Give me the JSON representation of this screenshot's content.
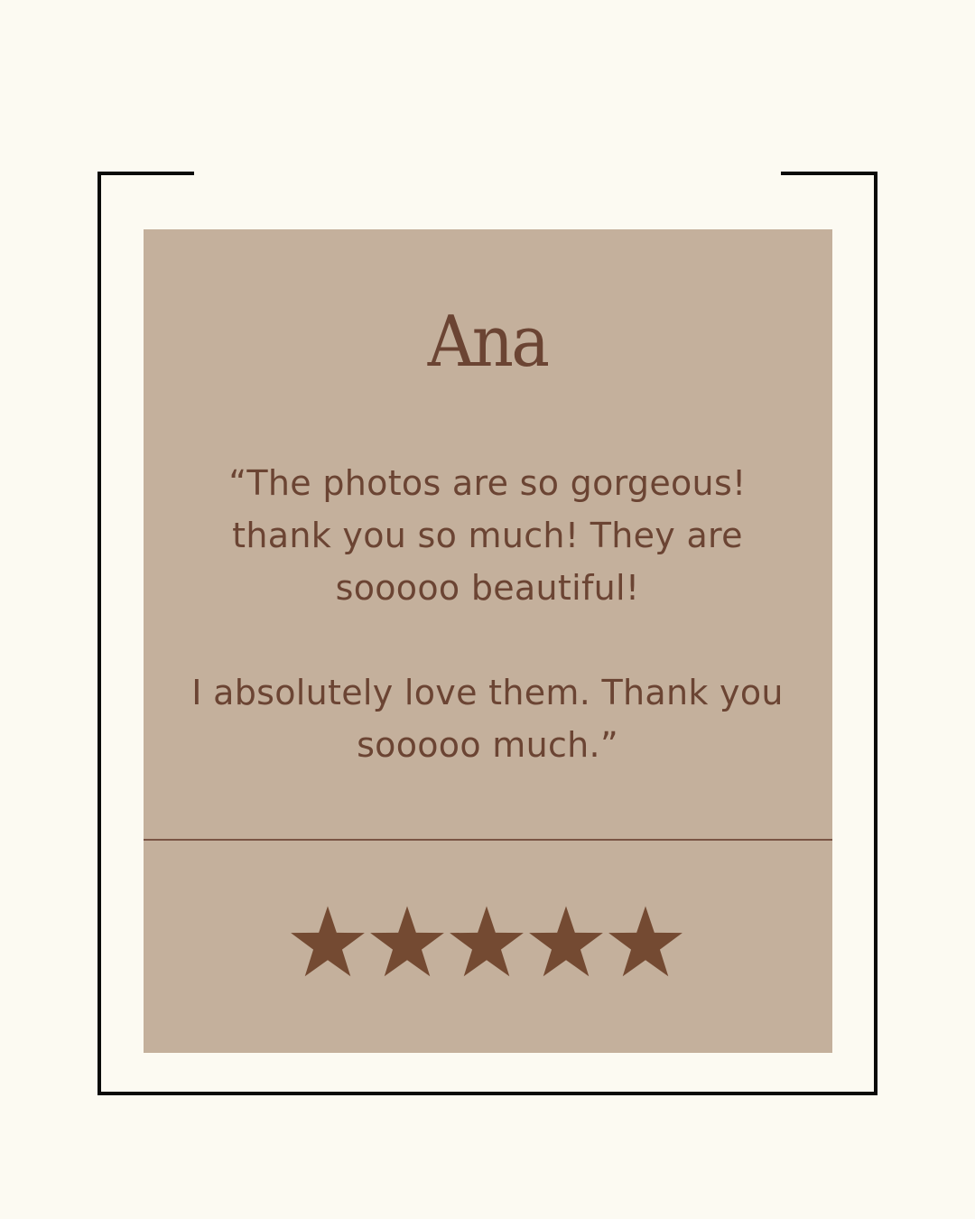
{
  "testimonial": {
    "name": "Ana",
    "quote_paragraph_1": "“The photos are so gorgeous! thank you so much! They are sooooo beautiful!",
    "quote_paragraph_2": "I absolutely love them. Thank you sooooo much.”",
    "rating": 5,
    "rating_max": 5,
    "star_icon": "star-icon"
  },
  "colors": {
    "background": "#fcfaf2",
    "card": "#c4b09c",
    "text": "#6b4433",
    "star": "#744a32",
    "frame": "#0a0a0a"
  }
}
